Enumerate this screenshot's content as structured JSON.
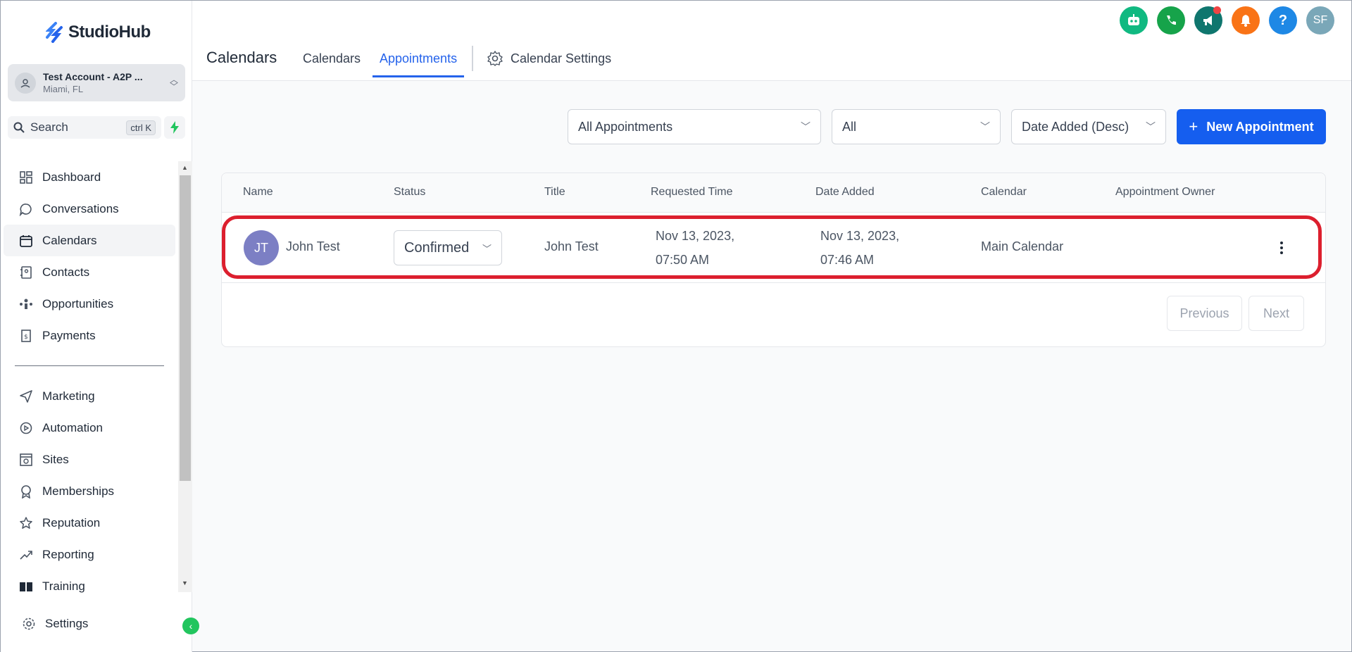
{
  "brand": {
    "name": "StudioHub",
    "accent": "#155eef",
    "logo_color": "#3b82f6"
  },
  "account": {
    "name": "Test Account - A2P ...",
    "location": "Miami, FL"
  },
  "search": {
    "label": "Search",
    "shortcut": "ctrl K"
  },
  "sidebar": {
    "items": [
      {
        "label": "Dashboard",
        "icon": "dashboard-icon"
      },
      {
        "label": "Conversations",
        "icon": "chat-icon"
      },
      {
        "label": "Calendars",
        "icon": "calendar-icon",
        "active": true
      },
      {
        "label": "Contacts",
        "icon": "contacts-icon"
      },
      {
        "label": "Opportunities",
        "icon": "opportunities-icon"
      },
      {
        "label": "Payments",
        "icon": "payments-icon"
      }
    ],
    "items2": [
      {
        "label": "Marketing",
        "icon": "send-icon"
      },
      {
        "label": "Automation",
        "icon": "automation-icon"
      },
      {
        "label": "Sites",
        "icon": "sites-icon"
      },
      {
        "label": "Memberships",
        "icon": "membership-icon"
      },
      {
        "label": "Reputation",
        "icon": "star-icon"
      },
      {
        "label": "Reporting",
        "icon": "trend-icon"
      },
      {
        "label": "Training",
        "icon": "book-icon"
      }
    ],
    "settings": "Settings"
  },
  "header": {
    "title": "Calendars",
    "tabs": [
      "Calendars",
      "Appointments"
    ],
    "active_tab": "Appointments",
    "settings_tab": "Calendar Settings",
    "top_icons": [
      {
        "name": "bot-icon",
        "color": "#10b981"
      },
      {
        "name": "phone-icon",
        "color": "#16a34a"
      },
      {
        "name": "megaphone-icon",
        "color": "#0f766e"
      },
      {
        "name": "bell-icon",
        "color": "#f97316"
      },
      {
        "name": "help-icon",
        "color": "#1e88e5"
      },
      {
        "name": "user-avatar",
        "color": "#7aa7b8",
        "initials": "SF"
      }
    ]
  },
  "filters": {
    "appointments": "All Appointments",
    "status": "All",
    "sort": "Date Added (Desc)",
    "new_button": "New Appointment"
  },
  "table": {
    "columns": [
      "Name",
      "Status",
      "Title",
      "Requested Time",
      "Date Added",
      "Calendar",
      "Appointment Owner"
    ],
    "rows": [
      {
        "initials": "JT",
        "name": "John Test",
        "status": "Confirmed",
        "title": "John Test",
        "requested_line1": "Nov 13, 2023,",
        "requested_line2": "07:50 AM",
        "added_line1": "Nov 13, 2023,",
        "added_line2": "07:46 AM",
        "calendar": "Main Calendar",
        "owner": ""
      }
    ]
  },
  "pagination": {
    "previous": "Previous",
    "next": "Next"
  }
}
